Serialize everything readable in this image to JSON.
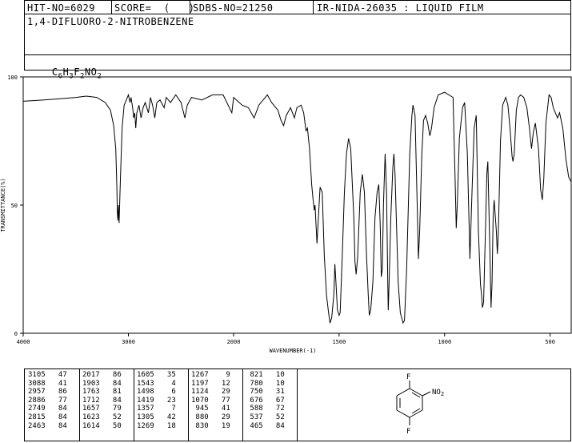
{
  "header": {
    "hit_no": "HIT-NO=6029",
    "score": "SCORE=  (   )",
    "sdbs_no": "SDBS-NO=21250",
    "ir_code": "IR-NIDA-26035 : LIQUID FILM",
    "compound": "1,4-DIFLUORO-2-NITROBENZENE"
  },
  "formula": {
    "parts": [
      "C",
      "6",
      "H",
      "3",
      "F",
      "2",
      "N",
      "O",
      "2"
    ]
  },
  "chart_data": {
    "type": "line",
    "xlabel": "WAVENUMBER(-1)",
    "ylabel": "TRANSMITTANCE(%)",
    "xlim": [
      4000,
      400
    ],
    "ylim": [
      0,
      100
    ],
    "x_ticks": [
      "4000",
      "3000",
      "2000",
      "1500",
      "1000",
      "500"
    ],
    "y_ticks": [
      "100",
      "50",
      "0"
    ],
    "series": [
      {
        "points": [
          [
            4000,
            90.5
          ],
          [
            3800,
            91
          ],
          [
            3650,
            91.5
          ],
          [
            3500,
            92
          ],
          [
            3400,
            92.5
          ],
          [
            3300,
            92
          ],
          [
            3220,
            90
          ],
          [
            3170,
            87
          ],
          [
            3140,
            81
          ],
          [
            3120,
            72
          ],
          [
            3110,
            58
          ],
          [
            3105,
            47
          ],
          [
            3100,
            44
          ],
          [
            3095,
            50
          ],
          [
            3088,
            43
          ],
          [
            3080,
            55
          ],
          [
            3060,
            80
          ],
          [
            3040,
            89
          ],
          [
            3020,
            91
          ],
          [
            3000,
            93
          ],
          [
            2985,
            90
          ],
          [
            2975,
            92
          ],
          [
            2960,
            88
          ],
          [
            2950,
            84
          ],
          [
            2940,
            86
          ],
          [
            2930,
            80
          ],
          [
            2920,
            86
          ],
          [
            2900,
            89
          ],
          [
            2880,
            84
          ],
          [
            2860,
            88
          ],
          [
            2840,
            90
          ],
          [
            2810,
            86
          ],
          [
            2790,
            92
          ],
          [
            2770,
            89
          ],
          [
            2749,
            84
          ],
          [
            2730,
            90
          ],
          [
            2700,
            91
          ],
          [
            2660,
            88
          ],
          [
            2640,
            92
          ],
          [
            2600,
            90
          ],
          [
            2550,
            93
          ],
          [
            2500,
            90
          ],
          [
            2463,
            84
          ],
          [
            2440,
            89
          ],
          [
            2400,
            92
          ],
          [
            2300,
            91
          ],
          [
            2200,
            93
          ],
          [
            2100,
            93
          ],
          [
            2017,
            86
          ],
          [
            2000,
            92
          ],
          [
            1960,
            89
          ],
          [
            1930,
            88
          ],
          [
            1903,
            84
          ],
          [
            1880,
            89
          ],
          [
            1860,
            91
          ],
          [
            1840,
            93
          ],
          [
            1820,
            90
          ],
          [
            1800,
            88
          ],
          [
            1790,
            87
          ],
          [
            1775,
            83
          ],
          [
            1763,
            81
          ],
          [
            1750,
            85
          ],
          [
            1730,
            88
          ],
          [
            1712,
            84
          ],
          [
            1700,
            88
          ],
          [
            1680,
            89
          ],
          [
            1668,
            86
          ],
          [
            1657,
            79
          ],
          [
            1650,
            80
          ],
          [
            1640,
            72
          ],
          [
            1630,
            58
          ],
          [
            1623,
            52
          ],
          [
            1618,
            48
          ],
          [
            1614,
            50
          ],
          [
            1605,
            35
          ],
          [
            1598,
            45
          ],
          [
            1590,
            57
          ],
          [
            1580,
            55
          ],
          [
            1570,
            30
          ],
          [
            1560,
            15
          ],
          [
            1550,
            8
          ],
          [
            1543,
            4
          ],
          [
            1535,
            6
          ],
          [
            1525,
            15
          ],
          [
            1520,
            27
          ],
          [
            1515,
            20
          ],
          [
            1508,
            9
          ],
          [
            1500,
            7
          ],
          [
            1495,
            8
          ],
          [
            1485,
            30
          ],
          [
            1475,
            55
          ],
          [
            1465,
            70
          ],
          [
            1455,
            76
          ],
          [
            1445,
            72
          ],
          [
            1430,
            45
          ],
          [
            1425,
            28
          ],
          [
            1419,
            23
          ],
          [
            1412,
            30
          ],
          [
            1400,
            55
          ],
          [
            1390,
            62
          ],
          [
            1380,
            55
          ],
          [
            1370,
            30
          ],
          [
            1362,
            15
          ],
          [
            1357,
            7
          ],
          [
            1350,
            9
          ],
          [
            1340,
            20
          ],
          [
            1330,
            45
          ],
          [
            1320,
            55
          ],
          [
            1312,
            58
          ],
          [
            1305,
            42
          ],
          [
            1300,
            22
          ],
          [
            1295,
            25
          ],
          [
            1290,
            50
          ],
          [
            1282,
            70
          ],
          [
            1275,
            55
          ],
          [
            1269,
            18
          ],
          [
            1267,
            9
          ],
          [
            1263,
            20
          ],
          [
            1255,
            45
          ],
          [
            1245,
            65
          ],
          [
            1240,
            70
          ],
          [
            1235,
            62
          ],
          [
            1220,
            20
          ],
          [
            1210,
            8
          ],
          [
            1197,
            4
          ],
          [
            1190,
            5
          ],
          [
            1180,
            25
          ],
          [
            1165,
            70
          ],
          [
            1155,
            85
          ],
          [
            1150,
            89
          ],
          [
            1140,
            85
          ],
          [
            1130,
            50
          ],
          [
            1124,
            29
          ],
          [
            1118,
            40
          ],
          [
            1108,
            70
          ],
          [
            1100,
            83
          ],
          [
            1090,
            85
          ],
          [
            1080,
            82
          ],
          [
            1070,
            77
          ],
          [
            1062,
            80
          ],
          [
            1050,
            88
          ],
          [
            1030,
            93
          ],
          [
            1000,
            94
          ],
          [
            960,
            92
          ],
          [
            950,
            60
          ],
          [
            945,
            41
          ],
          [
            940,
            50
          ],
          [
            930,
            76
          ],
          [
            925,
            80
          ],
          [
            915,
            88
          ],
          [
            905,
            90
          ],
          [
            892,
            70
          ],
          [
            880,
            29
          ],
          [
            870,
            55
          ],
          [
            860,
            80
          ],
          [
            850,
            85
          ],
          [
            840,
            40
          ],
          [
            830,
            19
          ],
          [
            825,
            15
          ],
          [
            821,
            10
          ],
          [
            815,
            12
          ],
          [
            805,
            45
          ],
          [
            800,
            62
          ],
          [
            795,
            67
          ],
          [
            785,
            30
          ],
          [
            780,
            10
          ],
          [
            775,
            20
          ],
          [
            770,
            45
          ],
          [
            765,
            52
          ],
          [
            755,
            40
          ],
          [
            750,
            31
          ],
          [
            745,
            40
          ],
          [
            735,
            75
          ],
          [
            725,
            89
          ],
          [
            710,
            92
          ],
          [
            700,
            89
          ],
          [
            690,
            80
          ],
          [
            680,
            69
          ],
          [
            676,
            67
          ],
          [
            670,
            70
          ],
          [
            660,
            87
          ],
          [
            650,
            92
          ],
          [
            640,
            93
          ],
          [
            625,
            92
          ],
          [
            610,
            88
          ],
          [
            598,
            80
          ],
          [
            588,
            72
          ],
          [
            580,
            78
          ],
          [
            570,
            82
          ],
          [
            555,
            72
          ],
          [
            545,
            56
          ],
          [
            537,
            52
          ],
          [
            530,
            60
          ],
          [
            520,
            82
          ],
          [
            505,
            93
          ],
          [
            495,
            92
          ],
          [
            485,
            88
          ],
          [
            475,
            86
          ],
          [
            465,
            84
          ],
          [
            455,
            86
          ],
          [
            440,
            80
          ],
          [
            425,
            68
          ],
          [
            412,
            61
          ],
          [
            400,
            59
          ]
        ]
      }
    ],
    "peak_table": [
      [
        "3105",
        "47"
      ],
      [
        "3088",
        "41"
      ],
      [
        "2957",
        "86"
      ],
      [
        "2886",
        "77"
      ],
      [
        "2749",
        "84"
      ],
      [
        "2815",
        "84"
      ],
      [
        "2463",
        "84"
      ],
      [
        "2017",
        "86"
      ],
      [
        "1903",
        "84"
      ],
      [
        "1763",
        "81"
      ],
      [
        "1712",
        "84"
      ],
      [
        "1657",
        "79"
      ],
      [
        "1623",
        "52"
      ],
      [
        "1614",
        "50"
      ],
      [
        "1605",
        "35"
      ],
      [
        "1543",
        "4"
      ],
      [
        "1498",
        "6"
      ],
      [
        "1419",
        "23"
      ],
      [
        "1357",
        "7"
      ],
      [
        "1305",
        "42"
      ],
      [
        "1269",
        "18"
      ],
      [
        "1267",
        "9"
      ],
      [
        "1197",
        "12"
      ],
      [
        "1124",
        "29"
      ],
      [
        "1070",
        "77"
      ],
      [
        "945",
        "41"
      ],
      [
        "880",
        "29"
      ],
      [
        "830",
        "19"
      ],
      [
        "821",
        "10"
      ],
      [
        "780",
        "10"
      ],
      [
        "750",
        "31"
      ],
      [
        "676",
        "67"
      ],
      [
        "588",
        "72"
      ],
      [
        "537",
        "52"
      ],
      [
        "465",
        "84"
      ]
    ]
  },
  "structure": {
    "labels": {
      "f_top": "F",
      "no2_main": "NO",
      "no2_sub": "2",
      "f_bottom": "F"
    }
  }
}
